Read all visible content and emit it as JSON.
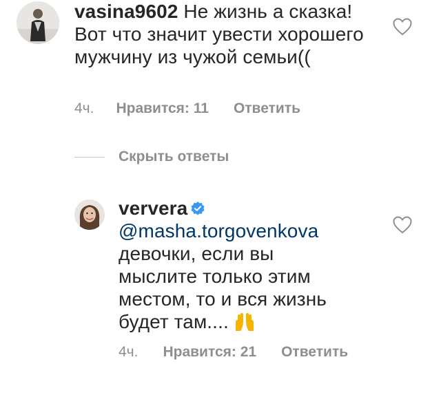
{
  "comments": [
    {
      "username": "vasina9602",
      "text": " Не жизнь а сказка! Вот что значит увести хорошего мужчину из чужой семьи((",
      "time": "4ч.",
      "likes": "Нравится: 11",
      "reply": "Ответить",
      "avatar_icon": "user-avatar",
      "like_icon": "heart-outline-icon"
    },
    {
      "username": "ververa",
      "verified": true,
      "mention": "@masha.torgovenkova",
      "text_lines": [
        "девочки, если вы",
        "мыслите только этим",
        "местом, то и вся жизнь",
        "будет там...."
      ],
      "emoji": "🙌",
      "time": "4ч.",
      "likes": "Нравится: 21",
      "reply": "Ответить",
      "avatar_icon": "user-avatar",
      "like_icon": "heart-outline-icon"
    }
  ],
  "hide_replies_label": "Скрыть ответы",
  "colors": {
    "text": "#262626",
    "secondary": "#8e8e8e",
    "mention": "#00376b",
    "verified": "#3897f0",
    "divider": "#c7c7c7"
  }
}
